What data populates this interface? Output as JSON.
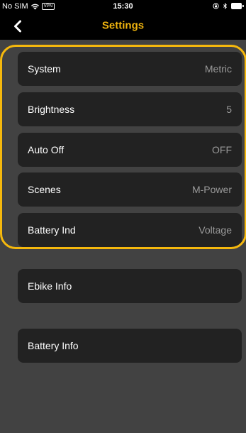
{
  "status_bar": {
    "carrier": "No SIM",
    "vpn": "VPN",
    "time": "15:30",
    "wifi_icon": "wifi-icon",
    "lock_icon": "orientation-lock-icon",
    "bluetooth_icon": "bluetooth-icon",
    "battery_icon": "battery-icon"
  },
  "nav": {
    "title": "Settings",
    "back_icon": "chevron-left-icon"
  },
  "colors": {
    "accent": "#f0b40e",
    "background": "#424242",
    "row_background": "#222222",
    "value_text": "#9a9a9a"
  },
  "settings_group": [
    {
      "label": "System",
      "value": "Metric"
    },
    {
      "label": "Brightness",
      "value": "5"
    },
    {
      "label": "Auto Off",
      "value": "OFF"
    },
    {
      "label": "Scenes",
      "value": "M-Power"
    },
    {
      "label": "Battery Ind",
      "value": "Voltage"
    }
  ],
  "info_items": [
    {
      "label": "Ebike Info"
    },
    {
      "label": "Battery Info"
    }
  ]
}
